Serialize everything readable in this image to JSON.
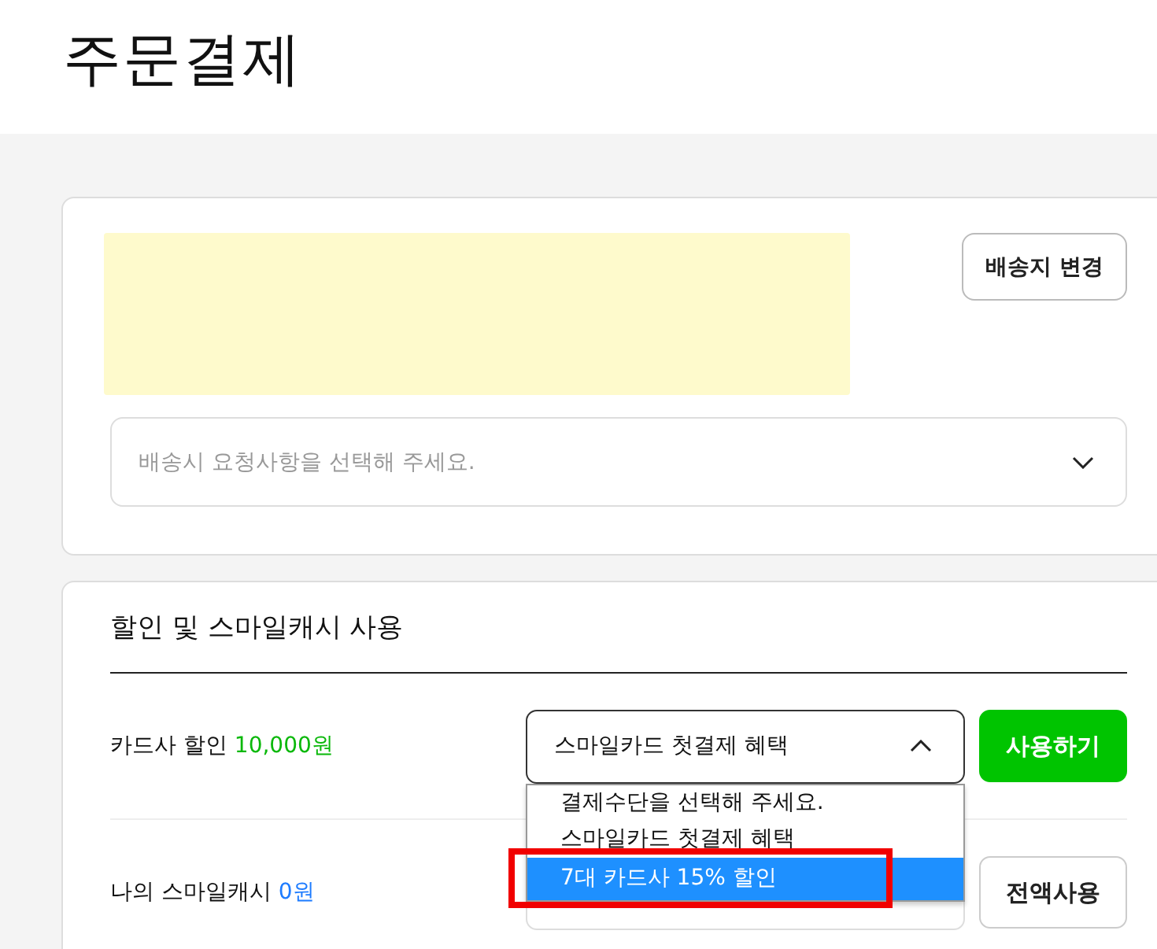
{
  "page_title": "주문결제",
  "address": {
    "change_button": "배송지 변경",
    "request_select": {
      "placeholder": "배송시 요청사항을 선택해 주세요.",
      "expanded": false
    }
  },
  "discounts": {
    "title": "할인 및 스마일캐시 사용",
    "card_discount": {
      "label": "카드사 할인",
      "amount": "10,000원",
      "select_value": "스마일카드 첫결제 혜택",
      "expanded": true,
      "button": "사용하기",
      "options": [
        {
          "label": "결제수단을 선택해 주세요.",
          "selected": false,
          "annotated": false
        },
        {
          "label": "스마일카드 첫결제 혜택",
          "selected": false,
          "annotated": false
        },
        {
          "label": "7대 카드사 15% 할인",
          "selected": true,
          "annotated": true
        }
      ]
    },
    "smile_cash": {
      "label": "나의 스마일캐시",
      "amount": "0원",
      "button": "전액사용"
    }
  }
}
